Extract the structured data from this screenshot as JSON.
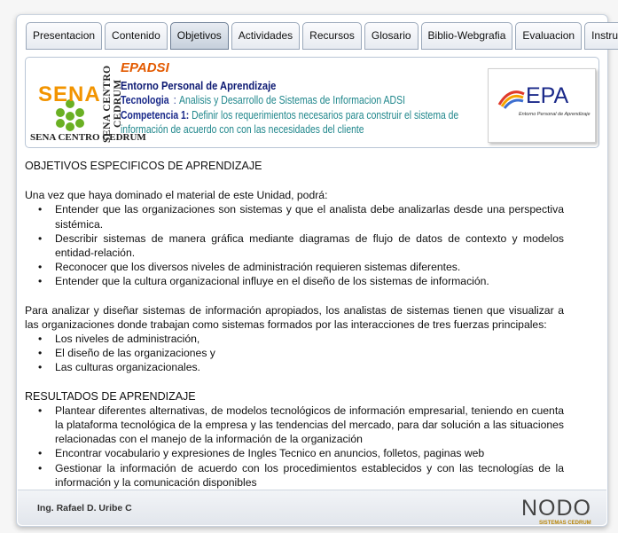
{
  "tabs": [
    "Presentacion",
    "Contenido",
    "Objetivos",
    "Actividades",
    "Recursos",
    "Glosario",
    "Biblio-Webgrafia",
    "Evaluacion",
    "Instructor"
  ],
  "active_tab": "Objetivos",
  "banner": {
    "sena_logo_text": "SENA",
    "sena_center_text": "SENA CENTRO CEDRUM",
    "epadsi": "EPADSI",
    "entorno": "Entorno Personal de Aprendizaje",
    "tecnologia_label": "Tecnologia",
    "tecnologia_value": "Analisis y Desarrollo de Sistemas de Informacion ADSI",
    "competencia_label": "Competencia 1:",
    "competencia_value": "Definir los requerimientos necesarios para construir el sistema de información de acuerdo con con las necesidades del cliente",
    "epa_logo": "EPA",
    "epa_subtitle": "Entorno Personal de Aprendizaje"
  },
  "content": {
    "heading1": "OBJETIVOS ESPECIFICOS DE APRENDIZAJE",
    "intro": "Una vez que haya dominado el material de este Unidad, podrá:",
    "objectives": [
      "Entender que las organizaciones son sistemas y que el analista debe analizarlas desde una perspectiva sistémica.",
      "Describir sistemas de manera gráfica mediante diagramas de flujo de datos de contexto y modelos entidad-relación.",
      "Reconocer que los diversos niveles de administración requieren sistemas diferentes.",
      "Entender que la cultura organizacional influye en el diseño de los sistemas de información."
    ],
    "paragraph2": "Para analizar y diseñar sistemas de información apropiados, los analistas de sistemas tienen que visualizar a las organizaciones donde trabajan como sistemas formados por las interacciones de tres fuerzas principales:",
    "forces": [
      "Los niveles de administración,",
      "El diseño de las organizaciones y",
      "Las culturas organizacionales."
    ],
    "heading2": "RESULTADOS DE APRENDIZAJE",
    "results": [
      "Plantear diferentes alternativas, de modelos tecnológicos de información empresarial, teniendo en cuenta la plataforma tecnológica de la empresa y las tendencias del mercado, para dar solución a las situaciones relacionadas con el manejo de la información de la organización",
      "Encontrar vocabulario  y expresiones de Ingles Tecnico en anuncios, folletos, paginas web",
      "Gestionar la información de acuerdo con los procedimientos establecidos y con las tecnologías de la información y la comunicación disponibles"
    ]
  },
  "footer": {
    "instructor": "Ing. Rafael D. Uribe C",
    "nodo_logo": "NODO",
    "nodo_sub": "SISTEMAS CEDRUM"
  }
}
